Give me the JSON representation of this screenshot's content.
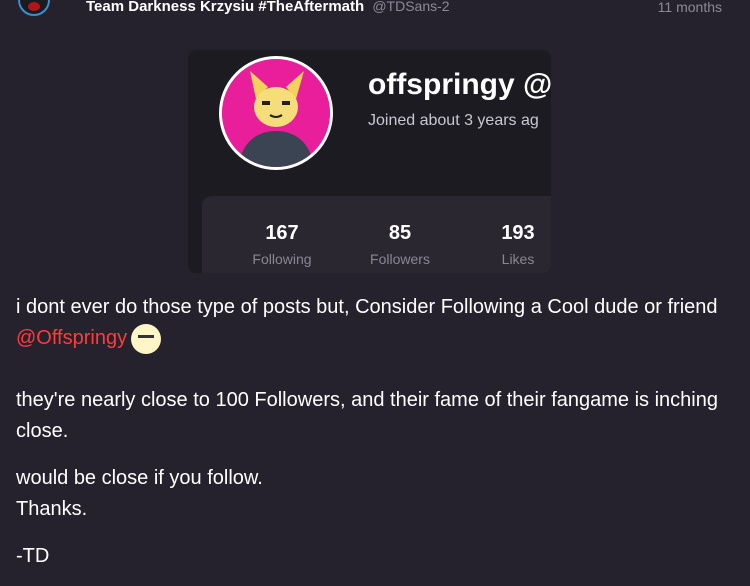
{
  "post": {
    "author": "Team Darkness Krzysiu #TheAftermath",
    "handle": "@TDSans-2",
    "time": "11 months"
  },
  "card": {
    "username": "offspringy @",
    "joined": "Joined about 3 years ag",
    "stats": [
      {
        "value": "167",
        "label": "Following"
      },
      {
        "value": "85",
        "label": "Followers"
      },
      {
        "value": "193",
        "label": "Likes"
      }
    ]
  },
  "body": {
    "line1": "i dont ever do those type of posts but, Consider Following a Cool dude or friend ",
    "mention": "@Offspringy",
    "line2": "they're nearly close to 100 Followers, and their fame of their fangame is inching close.",
    "line3a": "would be close if you follow.",
    "line3b": "Thanks.",
    "signoff": "-TD"
  }
}
